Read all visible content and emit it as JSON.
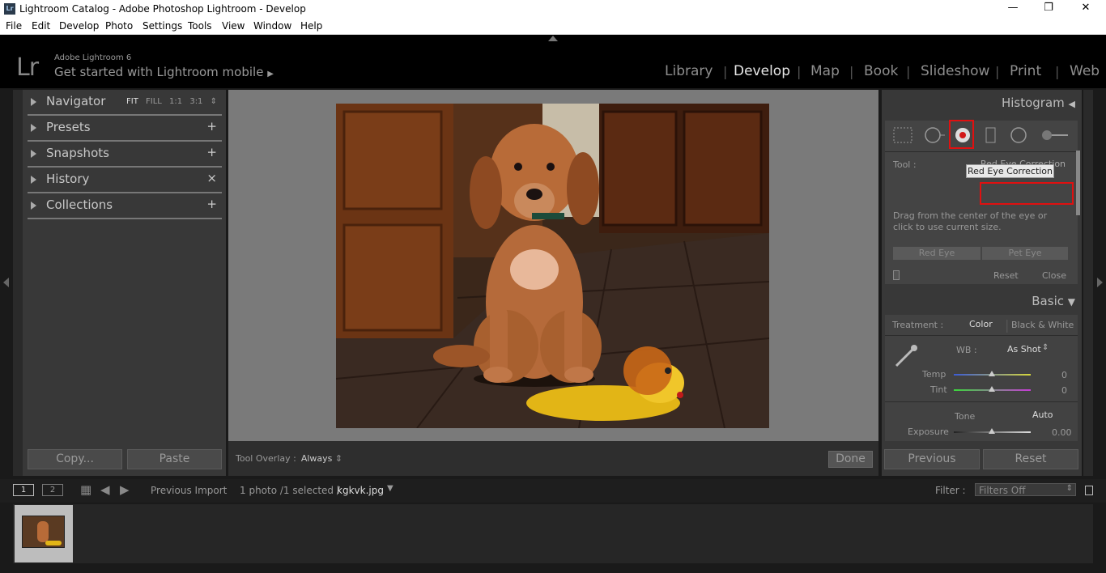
{
  "window": {
    "title": "Lightroom Catalog - Adobe Photoshop Lightroom - Develop",
    "app_icon": "Lr"
  },
  "menu": [
    "File",
    "Edit",
    "Develop",
    "Photo",
    "Settings",
    "Tools",
    "View",
    "Window",
    "Help"
  ],
  "identity": {
    "logo": "Lr",
    "product": "Adobe Lightroom 6",
    "mobile": "Get started with Lightroom mobile"
  },
  "modules": {
    "items": [
      "Library",
      "Develop",
      "Map",
      "Book",
      "Slideshow",
      "Print",
      "Web"
    ],
    "active": "Develop"
  },
  "left_panel": {
    "navigator": {
      "label": "Navigator",
      "zoom": [
        "FIT",
        "FILL",
        "1:1",
        "3:1"
      ]
    },
    "sections": [
      {
        "label": "Presets",
        "action": "+"
      },
      {
        "label": "Snapshots",
        "action": "+"
      },
      {
        "label": "History",
        "action": "×"
      },
      {
        "label": "Collections",
        "action": "+"
      }
    ],
    "copy_label": "Copy...",
    "paste_label": "Paste"
  },
  "toolbar": {
    "overlay_label": "Tool Overlay :",
    "overlay_value": "Always",
    "done_label": "Done"
  },
  "right_panel": {
    "histogram_label": "Histogram",
    "tool": {
      "label": "Tool :",
      "name": "Red Eye Correction",
      "tooltip": "Red Eye Correction",
      "mode_red": "Red Eye",
      "mode_pet": "Pet Eye",
      "help": "Drag from the center of the eye or click to use current size.",
      "reset_label": "Reset",
      "close_label": "Close"
    },
    "basic": {
      "label": "Basic",
      "treatment_label": "Treatment :",
      "treatment_color": "Color",
      "treatment_bw": "Black & White",
      "wb_label": "WB :",
      "wb_value": "As Shot",
      "temp_label": "Temp",
      "temp_value": "0",
      "tint_label": "Tint",
      "tint_value": "0",
      "tone_label": "Tone",
      "auto_label": "Auto",
      "exposure_label": "Exposure",
      "exposure_value": "0.00"
    },
    "previous_label": "Previous",
    "reset_label": "Reset"
  },
  "filmbar": {
    "view1": "1",
    "view2": "2",
    "source": "Previous Import",
    "count": "1 photo /1 selected /",
    "filename": "kgkvk.jpg",
    "filter_label": "Filter :",
    "filter_value": "Filters Off"
  },
  "colors": {
    "accent_red": "#e01010",
    "panel": "#383838",
    "background": "#1a1a1a"
  }
}
